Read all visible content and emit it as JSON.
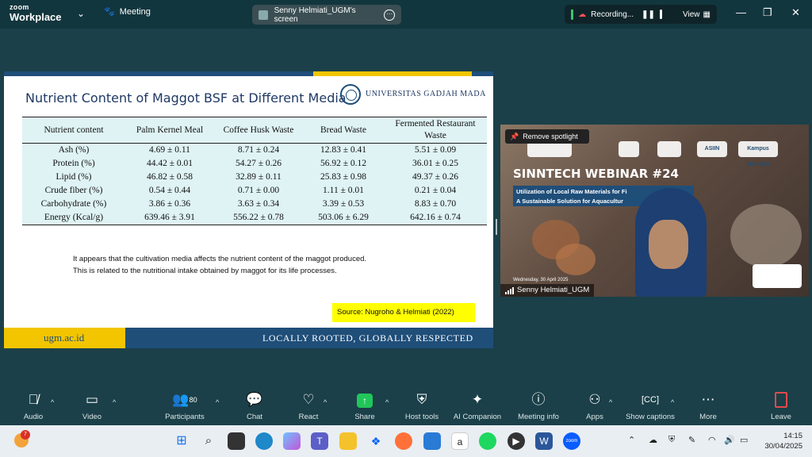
{
  "topbar": {
    "logo_line1": "zoom",
    "logo_line2": "Workplace",
    "meeting_label": "Meeting",
    "share_label": "Senny Helmiati_UGM's screen",
    "recording_label": "Recording...",
    "view_label": "View"
  },
  "slide": {
    "title": "Nutrient Content of Maggot BSF at Different Media",
    "university": "UNIVERSITAS GADJAH MADA",
    "table": {
      "headers": [
        "Nutrient content",
        "Palm Kernel Meal",
        "Coffee Husk Waste",
        "Bread Waste",
        "Fermented Restaurant Waste"
      ],
      "rows": [
        [
          "Ash (%)",
          "4.69 ± 0.11",
          "8.71 ± 0.24",
          "12.83 ± 0.41",
          "5.51 ± 0.09"
        ],
        [
          "Protein (%)",
          "44.42 ± 0.01",
          "54.27 ± 0.26",
          "56.92 ± 0.12",
          "36.01 ± 0.25"
        ],
        [
          "Lipid (%)",
          "46.82 ± 0.58",
          "32.89 ± 0.11",
          "25.83 ± 0.98",
          "49.37 ± 0.26"
        ],
        [
          "Crude fiber (%)",
          "0.54 ± 0.44",
          "0.71 ± 0.00",
          "1.11 ± 0.01",
          "0.21 ± 0.04"
        ],
        [
          "Carbohydrate (%)",
          "3.86 ± 0.36",
          "3.63 ± 0.34",
          "3.39 ± 0.53",
          "8.83 ± 0.70"
        ],
        [
          "Energy (Kcal/g)",
          "639.46 ± 3.91",
          "556.22 ± 0.78",
          "503.06 ± 6.29",
          "642.16 ± 0.74"
        ]
      ]
    },
    "note_line1": "It appears that the cultivation media affects the nutrient content of the maggot produced.",
    "note_line2": "This is related to the nutritional intake obtained by maggot for its life processes.",
    "source": "Source: Nugroho & Helmiati (2022)",
    "footer_url": "ugm.ac.id",
    "footer_tagline": "LOCALLY ROOTED, GLOBALLY RESPECTED"
  },
  "video": {
    "spotlight_label": "Remove spotlight",
    "webinar_title": "SINNTECH WEBINAR #24",
    "banner_line1": "Utilization of Local Raw Materials for Fi",
    "banner_line2": "A Sustainable Solution for Aquacultur",
    "date": "Wednesday, 30 April 2025",
    "logos": [
      "ASIIN",
      "Kampus Merdeka"
    ],
    "participant_name": "Senny Helmiati_UGM"
  },
  "toolbar": {
    "audio": "Audio",
    "video": "Video",
    "participants": "Participants",
    "participants_count": "80",
    "chat": "Chat",
    "react": "React",
    "share": "Share",
    "host_tools": "Host tools",
    "ai_companion": "AI Companion",
    "meeting_info": "Meeting info",
    "apps": "Apps",
    "show_captions": "Show captions",
    "more": "More",
    "leave": "Leave"
  },
  "taskbar": {
    "notification_count": "7",
    "time": "14:15",
    "date": "30/04/2025"
  }
}
